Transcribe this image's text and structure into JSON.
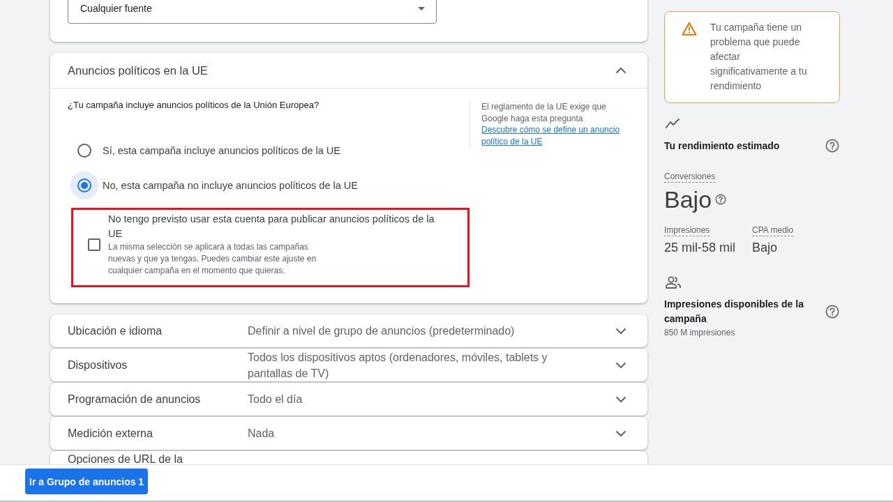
{
  "source_filter": {
    "value": "Cualquier fuente"
  },
  "eu_political_ads": {
    "title": "Anuncios políticos en la UE",
    "expanded": true,
    "question": "¿Tu campaña incluye anuncios políticos de la Unión Europea?",
    "options": [
      {
        "label": "Sí, esta campaña incluye anuncios políticos de la UE",
        "selected": false
      },
      {
        "label": "No, esta campaña no incluye anuncios políticos de la UE",
        "selected": true
      }
    ],
    "opt_out": {
      "label": "No tengo previsto usar esta cuenta para publicar anuncios políticos de la UE",
      "description": "La misma selección se aplicará a todas las campañas nuevas y que ya tengas. Puedes cambiar este ajuste en cualquier campaña en el momento que quieras.",
      "checked": false,
      "highlighted": true
    },
    "info": {
      "text": "El reglamento de la UE exige que Google haga esta pregunta",
      "link": "Descubre cómo se define un anuncio político de la UE"
    }
  },
  "settings": [
    {
      "title": "Ubicación e idioma",
      "value": "Definir a nivel de grupo de anuncios (predeterminado)",
      "expanded": false
    },
    {
      "title": "Dispositivos",
      "value": "Todos los dispositivos aptos (ordenadores, móviles, tablets y pantallas de TV)",
      "expanded": false
    },
    {
      "title": "Programación de anuncios",
      "value": "Todo el día",
      "expanded": false
    },
    {
      "title": "Medición externa",
      "value": "Nada",
      "expanded": false
    },
    {
      "title": "Opciones de URL de la"
    }
  ],
  "side_panel": {
    "alert": {
      "text": "Tu campaña tiene un problema que puede afectar significativamente a tu rendimiento"
    },
    "performance": {
      "title": "Tu rendimiento estimado",
      "metrics": [
        {
          "kind": "headline",
          "label": "Conversiones",
          "value": "Bajo"
        },
        {
          "kind": "inline",
          "label": "Impresiones",
          "value": "25 mil-58 mil"
        },
        {
          "kind": "inline",
          "label": "CPA medio",
          "value": "Bajo"
        }
      ]
    },
    "reach": {
      "title": "Impresiones disponibles de la campaña",
      "value": "850 M impresiones"
    }
  },
  "footer": {
    "button": "Ir a Grupo de anuncios 1"
  }
}
